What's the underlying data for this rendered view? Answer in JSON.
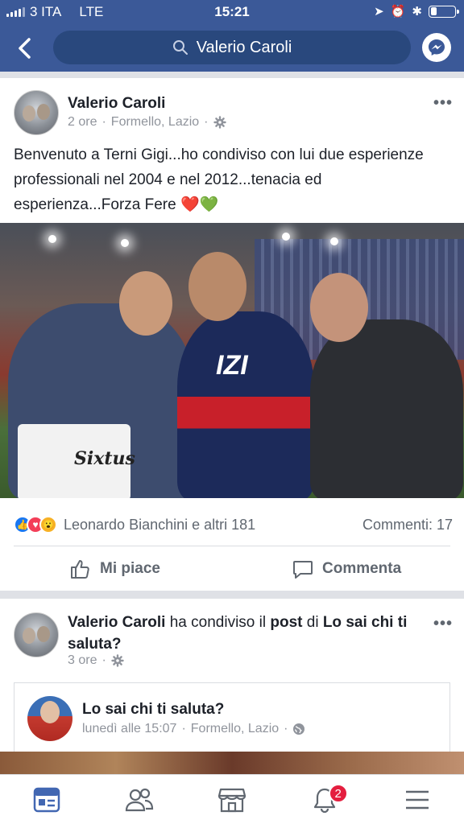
{
  "status_bar": {
    "carrier": "3 ITA",
    "network": "LTE",
    "time": "15:21"
  },
  "header": {
    "search_text": "Valerio Caroli"
  },
  "post1": {
    "author": "Valerio Caroli",
    "time": "2 ore",
    "location": "Formello, Lazio",
    "separator": "·",
    "text": "Benvenuto a Terni Gigi...ho condiviso con lui due esperienze professionali nel 2004 e nel 2012...tenacia ed esperienza...Forza Fere ❤️💚",
    "photo_texts": {
      "jersey": "IZI",
      "bag_brand": "Sixtus"
    },
    "reactions_text": "Leonardo Bianchini e altri 181",
    "comments_text": "Commenti: 17",
    "like_label": "Mi piace",
    "comment_label": "Commenta"
  },
  "post2": {
    "author": "Valerio Caroli",
    "shared_text": "ha condiviso il",
    "post_word": "post",
    "of_word": "di",
    "page_name": "Lo sai chi ti saluta?",
    "time": "3 ore",
    "inner": {
      "title": "Lo sai chi ti saluta?",
      "time": "lunedì alle 15:07",
      "location": "Formello, Lazio"
    }
  },
  "bottom_nav": {
    "notifications_badge": "2",
    "active_tab": "news-feed"
  },
  "colors": {
    "header_bg": "#3b5998",
    "search_bg": "#29487d",
    "badge": "#e41e3f",
    "active_nav": "#4267b2"
  }
}
